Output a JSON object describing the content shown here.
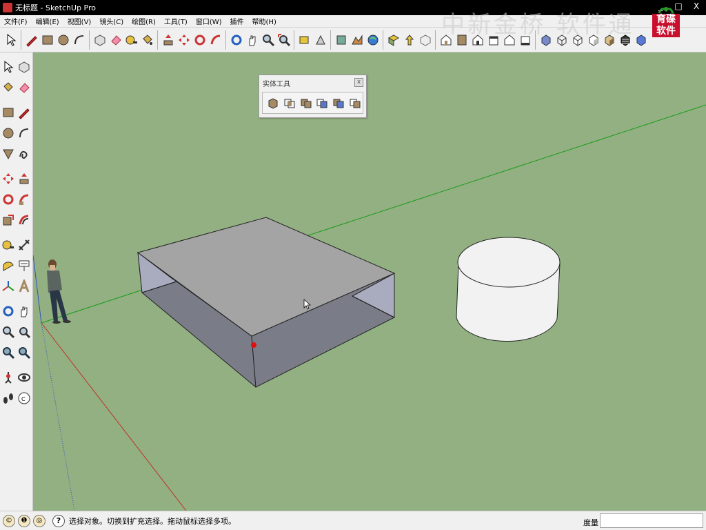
{
  "window": {
    "title": "无标题 - SketchUp Pro",
    "minimize": "_",
    "maximize": "□",
    "close": "X"
  },
  "watermark": "中新金桥 软件通",
  "logo": {
    "line1": "育碟",
    "line2": "软件"
  },
  "menu": [
    {
      "label": "文件(F)"
    },
    {
      "label": "编辑(E)"
    },
    {
      "label": "视图(V)"
    },
    {
      "label": "镜头(C)"
    },
    {
      "label": "绘图(R)"
    },
    {
      "label": "工具(T)"
    },
    {
      "label": "窗口(W)"
    },
    {
      "label": "插件"
    },
    {
      "label": "帮助(H)"
    }
  ],
  "solid_panel": {
    "title": "实体工具",
    "close": "x"
  },
  "status": {
    "message": "选择对象。切换到扩充选择。拖动鼠标选择多项。",
    "measure_label": "度量",
    "measure_value": "",
    "help_glyph": "?",
    "dial_1": "©",
    "dial_2": "❶",
    "dial_3": "◎"
  },
  "colors": {
    "viewport_bg": "#92b082",
    "box_top": "#a4a4a4",
    "box_side": "#a9abbf",
    "box_inner": "#7a7c87",
    "cylinder": "#f2f2f2",
    "green_axis": "#1c9a1c",
    "red_axis": "#c0302a",
    "blue_axis": "#3050c0"
  }
}
